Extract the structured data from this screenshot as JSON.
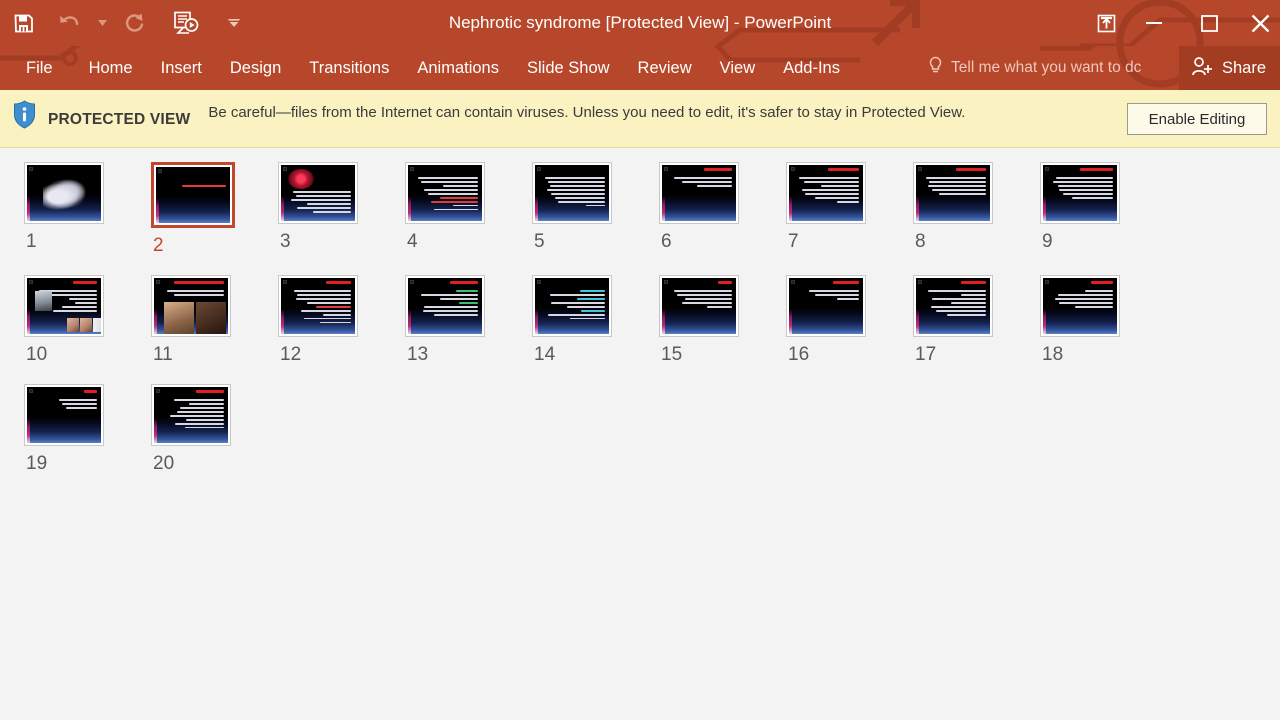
{
  "window": {
    "title": "Nephrotic syndrome [Protected View] - PowerPoint",
    "minimize_label": "Minimize",
    "restore_label": "Restore Down",
    "close_label": "Close",
    "upload_label": "Upload",
    "theme_color": "#b7472a",
    "share_bg": "#a33d22"
  },
  "quick_access": {
    "save": "Save",
    "undo": "Undo",
    "undo_caret": "Undo options",
    "redo": "Redo",
    "present": "Start From Beginning",
    "customize": "Customize Quick Access Toolbar"
  },
  "ribbon": {
    "tabs": [
      {
        "label": "File"
      },
      {
        "label": "Home"
      },
      {
        "label": "Insert"
      },
      {
        "label": "Design"
      },
      {
        "label": "Transitions"
      },
      {
        "label": "Animations"
      },
      {
        "label": "Slide Show"
      },
      {
        "label": "Review"
      },
      {
        "label": "View"
      },
      {
        "label": "Add-Ins"
      }
    ],
    "tell_me": "Tell me what you want to dc",
    "share": "Share"
  },
  "protected_view": {
    "label": "PROTECTED VIEW",
    "message": "Be careful—files from the Internet can contain viruses. Unless you need to edit, it's safer to stay in Protected View.",
    "enable_button": "Enable Editing",
    "bar_color": "#faf2c0"
  },
  "slide_sorter": {
    "selected_slide": 2,
    "selection_color": "#c0492b",
    "slides": [
      {
        "number": "1",
        "kind": "title-art",
        "title_lines": [],
        "body_lines": []
      },
      {
        "number": "2",
        "kind": "title-text",
        "title_lines": [],
        "body_lines": [
          "red-70"
        ]
      },
      {
        "number": "3",
        "kind": "photo-red",
        "title_lines": [],
        "body_lines": [
          "w-92",
          "w-88",
          "w-95",
          "w-70",
          "w-85",
          "w-60"
        ]
      },
      {
        "number": "4",
        "kind": "text",
        "title_lines": [
          "w-0"
        ],
        "body_lines": [
          "w-95",
          "w-90",
          "w-55",
          "w-85",
          "w-80",
          "red-60",
          "red-75",
          "w-40",
          "w-70"
        ]
      },
      {
        "number": "5",
        "kind": "text",
        "title_lines": [],
        "body_lines": [
          "w-95",
          "w-90",
          "w-88",
          "w-92",
          "w-85",
          "w-80",
          "w-75",
          "w-30"
        ]
      },
      {
        "number": "6",
        "kind": "text",
        "title_lines": [
          "w-45"
        ],
        "body_lines": [
          "w-92",
          "w-80",
          "w-55"
        ]
      },
      {
        "number": "7",
        "kind": "text",
        "title_lines": [
          "w-50"
        ],
        "body_lines": [
          "w-95",
          "w-88",
          "w-60",
          "w-90",
          "w-85",
          "w-70",
          "w-35"
        ]
      },
      {
        "number": "8",
        "kind": "text",
        "title_lines": [
          "w-48"
        ],
        "body_lines": [
          "w-95",
          "w-90",
          "w-92",
          "w-85",
          "w-75"
        ]
      },
      {
        "number": "9",
        "kind": "text",
        "title_lines": [
          "w-52"
        ],
        "body_lines": [
          "w-90",
          "w-95",
          "w-88",
          "w-85",
          "w-80",
          "w-65"
        ]
      },
      {
        "number": "10",
        "kind": "photo-xray",
        "title_lines": [
          "w-38"
        ],
        "body_lines": [
          "w-92",
          "w-85",
          "w-45",
          "w-35",
          "w-55",
          "w-70"
        ]
      },
      {
        "number": "11",
        "kind": "photo-legs",
        "title_lines": [
          "w-80"
        ],
        "body_lines": [
          "w-90",
          "w-80"
        ]
      },
      {
        "number": "12",
        "kind": "text",
        "title_lines": [
          "w-40"
        ],
        "body_lines": [
          "w-90",
          "w-85",
          "w-88",
          "w-70",
          "red-55",
          "w-80",
          "w-45",
          "w-75",
          "w-50"
        ]
      },
      {
        "number": "13",
        "kind": "text-green",
        "title_lines": [
          "w-45"
        ],
        "body_lines": [
          "green-35",
          "w-90",
          "w-60",
          "green-30",
          "w-85",
          "w-88",
          "w-70"
        ]
      },
      {
        "number": "14",
        "kind": "text-cyan",
        "title_lines": [],
        "body_lines": [
          "cyan-40",
          "w-88",
          "cyan-45",
          "w-85",
          "w-60",
          "cyan-38",
          "w-90",
          "w-55"
        ]
      },
      {
        "number": "15",
        "kind": "text",
        "title_lines": [
          "w-22"
        ],
        "body_lines": [
          "w-92",
          "w-88",
          "w-75",
          "w-80",
          "w-40"
        ]
      },
      {
        "number": "16",
        "kind": "text",
        "title_lines": [
          "w-42"
        ],
        "body_lines": [
          "w-80",
          "w-70",
          "w-35"
        ]
      },
      {
        "number": "17",
        "kind": "text",
        "title_lines": [
          "w-40"
        ],
        "body_lines": [
          "w-92",
          "w-40",
          "w-85",
          "w-55",
          "w-88",
          "w-80",
          "w-62"
        ]
      },
      {
        "number": "18",
        "kind": "text",
        "title_lines": [
          "w-35"
        ],
        "body_lines": [
          "w-45",
          "w-88",
          "w-92",
          "w-85",
          "w-60"
        ]
      },
      {
        "number": "19",
        "kind": "text",
        "title_lines": [
          "w-20"
        ],
        "body_lines": [
          "w-60",
          "w-55",
          "w-50"
        ]
      },
      {
        "number": "20",
        "kind": "text",
        "title_lines": [
          "w-45"
        ],
        "body_lines": [
          "w-80",
          "w-55",
          "w-70",
          "w-75",
          "w-85",
          "w-60",
          "w-78",
          "w-62"
        ]
      }
    ]
  }
}
